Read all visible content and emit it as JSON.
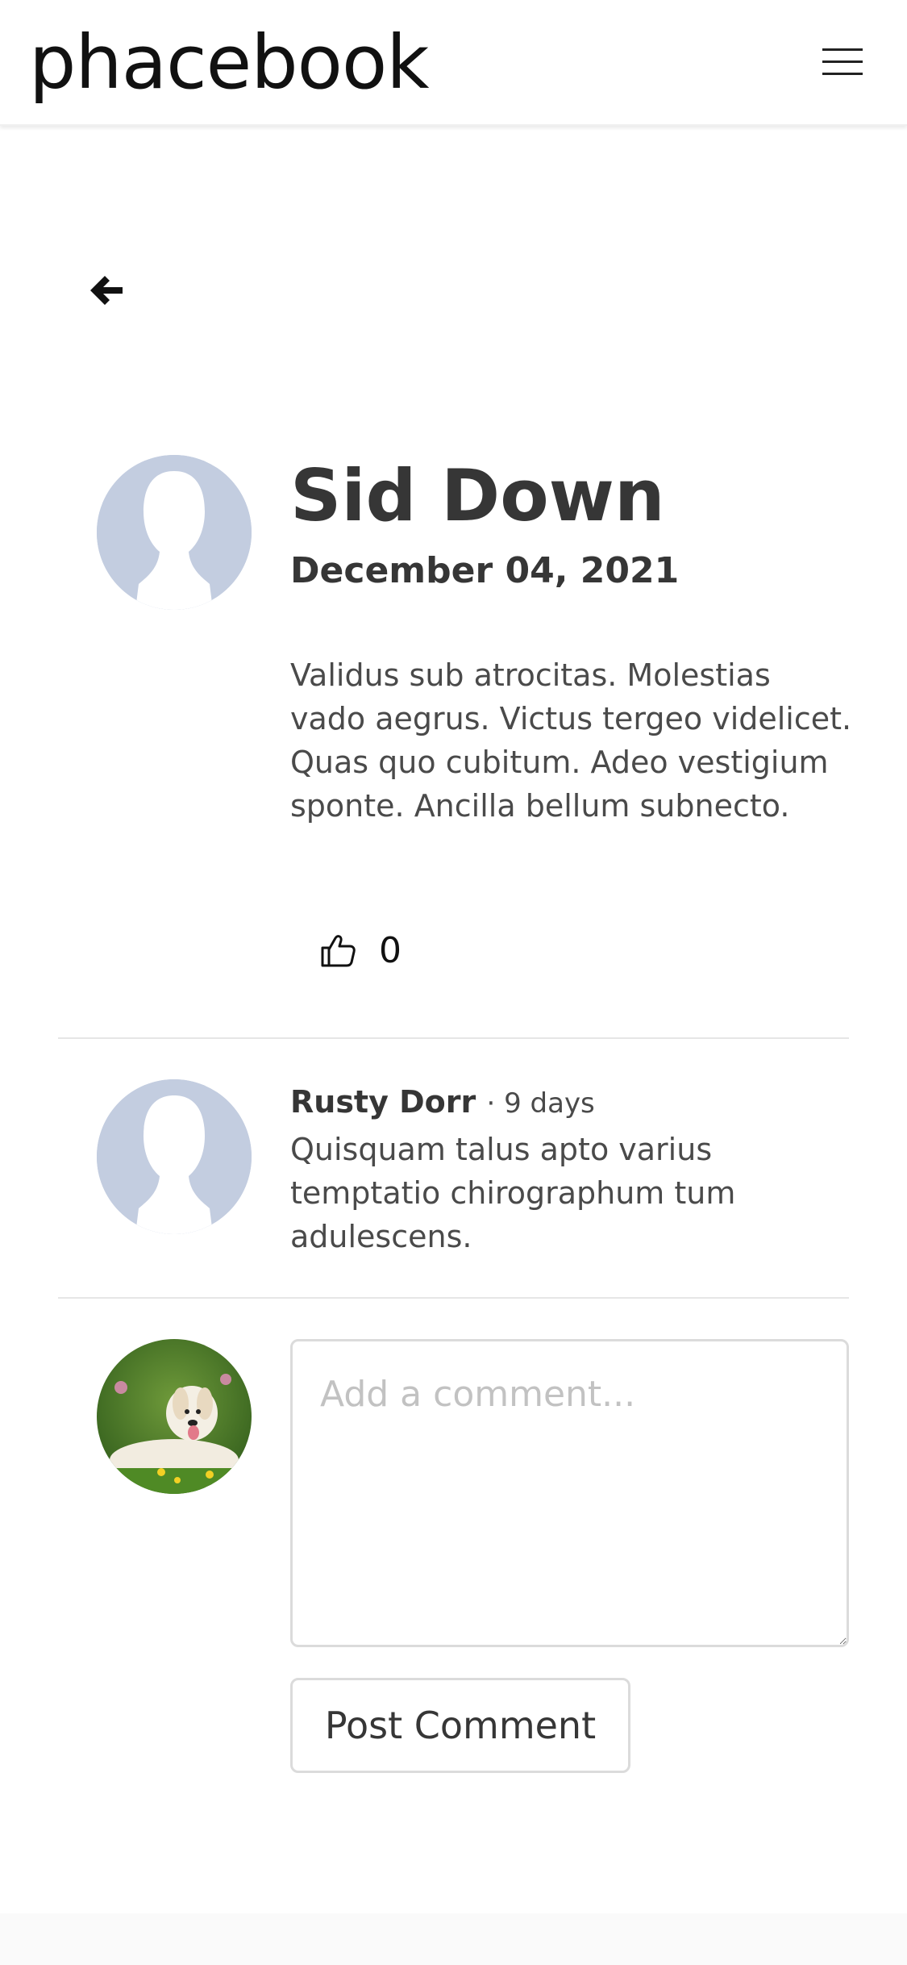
{
  "navbar": {
    "brand": "phacebook",
    "menu_icon": "hamburger-menu-icon"
  },
  "back": {
    "icon": "arrow-left-icon"
  },
  "post": {
    "author": "Sid Down",
    "date": "December 04, 2021",
    "body": "Validus sub atrocitas. Molestias vado aegrus. Victus tergeo videlicet. Quas quo cubitum. Adeo vestigium sponte. Ancilla bellum subnecto.",
    "like_icon": "thumbs-up-icon",
    "like_count": "0",
    "avatar": "default-profile-silhouette"
  },
  "comments": [
    {
      "author": "Rusty Dorr",
      "time": "· 9 days",
      "body": "Quisquam talus apto varius temptatio chirographum tum adulescens.",
      "avatar": "default-profile-silhouette"
    }
  ],
  "compose": {
    "avatar": "current-user-dog-photo",
    "placeholder": "Add a comment...",
    "submit_label": "Post Comment"
  },
  "colors": {
    "silhouette_bg": "#c3cde0",
    "text": "#363636",
    "border": "#dbdbdb"
  }
}
